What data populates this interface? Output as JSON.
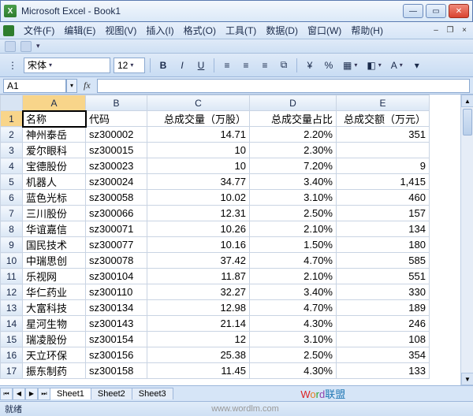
{
  "window": {
    "title": "Microsoft Excel - Book1"
  },
  "menu": {
    "file": "文件(F)",
    "edit": "编辑(E)",
    "view": "视图(V)",
    "insert": "插入(I)",
    "format": "格式(O)",
    "tools": "工具(T)",
    "data": "数据(D)",
    "window": "窗口(W)",
    "help": "帮助(H)"
  },
  "format_toolbar": {
    "font_name": "宋体",
    "font_size": "12"
  },
  "namebox": {
    "value": "A1",
    "fx_label": "fx"
  },
  "columns": [
    "A",
    "B",
    "C",
    "D",
    "E"
  ],
  "headers": {
    "name": "名称",
    "code": "代码",
    "volume": "总成交量（万股）",
    "ratio": "总成交量占比",
    "amount": "总成交额（万元）"
  },
  "rows": [
    {
      "name": "神州泰岳",
      "code": "sz300002",
      "vol": "14.71",
      "ratio": "2.20%",
      "amt": "351"
    },
    {
      "name": "爱尔眼科",
      "code": "sz300015",
      "vol": "10",
      "ratio": "2.30%",
      "amt": ""
    },
    {
      "name": "宝德股份",
      "code": "sz300023",
      "vol": "10",
      "ratio": "7.20%",
      "amt": "9"
    },
    {
      "name": "机器人",
      "code": "sz300024",
      "vol": "34.77",
      "ratio": "3.40%",
      "amt": "1,415"
    },
    {
      "name": "蓝色光标",
      "code": "sz300058",
      "vol": "10.02",
      "ratio": "3.10%",
      "amt": "460"
    },
    {
      "name": "三川股份",
      "code": "sz300066",
      "vol": "12.31",
      "ratio": "2.50%",
      "amt": "157"
    },
    {
      "name": "华谊嘉信",
      "code": "sz300071",
      "vol": "10.26",
      "ratio": "2.10%",
      "amt": "134"
    },
    {
      "name": "国民技术",
      "code": "sz300077",
      "vol": "10.16",
      "ratio": "1.50%",
      "amt": "180"
    },
    {
      "name": "中瑞思创",
      "code": "sz300078",
      "vol": "37.42",
      "ratio": "4.70%",
      "amt": "585"
    },
    {
      "name": "乐视网",
      "code": "sz300104",
      "vol": "11.87",
      "ratio": "2.10%",
      "amt": "551"
    },
    {
      "name": "华仁药业",
      "code": "sz300110",
      "vol": "32.27",
      "ratio": "3.40%",
      "amt": "330"
    },
    {
      "name": "大富科技",
      "code": "sz300134",
      "vol": "12.98",
      "ratio": "4.70%",
      "amt": "189"
    },
    {
      "name": "星河生物",
      "code": "sz300143",
      "vol": "21.14",
      "ratio": "4.30%",
      "amt": "246"
    },
    {
      "name": "瑞凌股份",
      "code": "sz300154",
      "vol": "12",
      "ratio": "3.10%",
      "amt": "108"
    },
    {
      "name": "天立环保",
      "code": "sz300156",
      "vol": "25.38",
      "ratio": "2.50%",
      "amt": "354"
    },
    {
      "name": "振东制药",
      "code": "sz300158",
      "vol": "11.45",
      "ratio": "4.30%",
      "amt": "133"
    }
  ],
  "sheets": {
    "s1": "Sheet1",
    "s2": "Sheet2",
    "s3": "Sheet3"
  },
  "status": {
    "ready": "就绪"
  },
  "watermark": {
    "brand": "Word联盟",
    "url": "www.wordlm.com"
  }
}
